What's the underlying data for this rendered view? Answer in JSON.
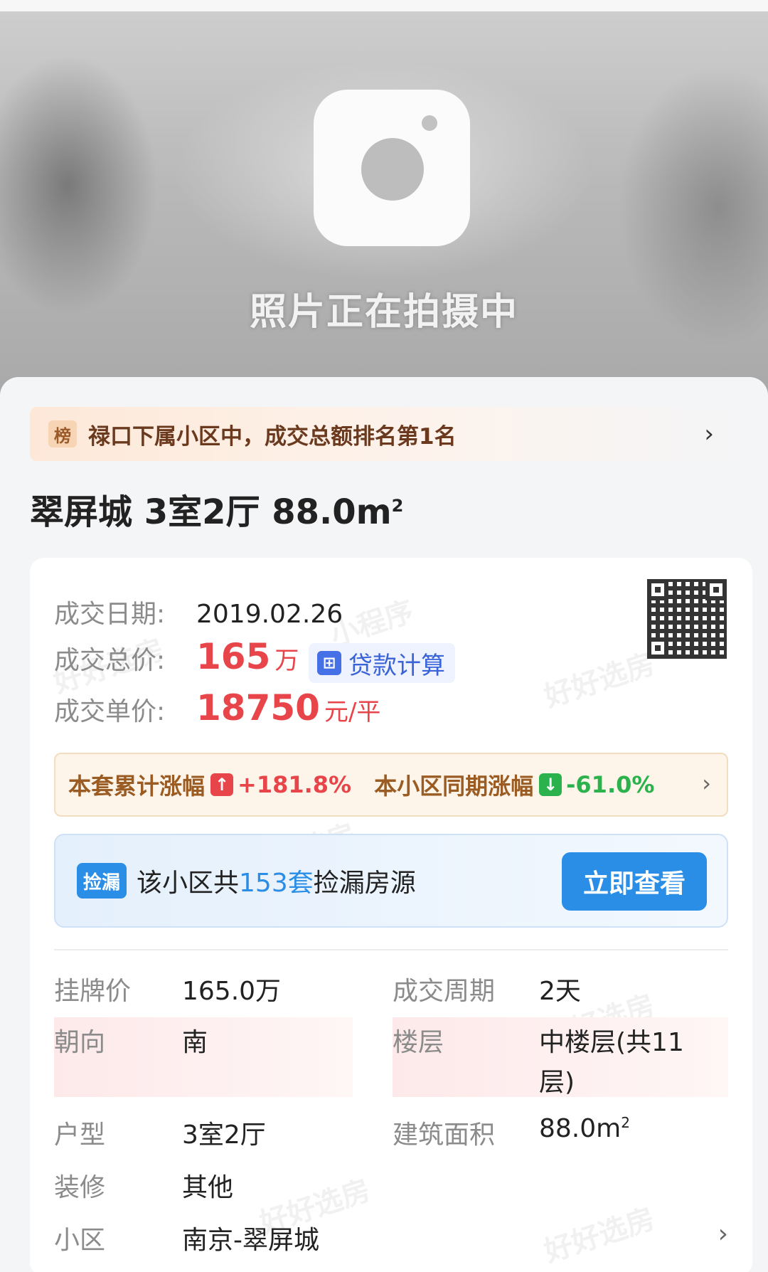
{
  "hero": {
    "caption": "照片正在拍摄中",
    "icon": "camera-icon"
  },
  "rank": {
    "tag": "榜",
    "text": "禄口下属小区中，成交总额排名第1名"
  },
  "title": {
    "text": "翠屏城 3室2厅 88.0m",
    "sup": "2"
  },
  "deal": {
    "date_label": "成交日期:",
    "date_value": "2019.02.26",
    "total_label": "成交总价:",
    "total_value": "165",
    "total_unit": "万",
    "loan_button": "贷款计算",
    "unit_label": "成交单价:",
    "unit_value": "18750",
    "unit_unit": "元/平"
  },
  "trend": {
    "own_label": "本套累计涨幅",
    "own_value": "+181.8%",
    "community_label": "本小区同期涨幅",
    "community_value": "-61.0%"
  },
  "leak": {
    "tag": "捡漏",
    "text_prefix": "该小区共",
    "count": "153套",
    "text_suffix": "捡漏房源",
    "button": "立即查看"
  },
  "details": {
    "listing_price_label": "挂牌价",
    "listing_price_value": "165.0万",
    "cycle_label": "成交周期",
    "cycle_value": "2天",
    "orientation_label": "朝向",
    "orientation_value": "南",
    "floor_label": "楼层",
    "floor_value_line1": "中楼层(共11",
    "floor_value_line2": "层)",
    "layout_label": "户型",
    "layout_value": "3室2厅",
    "area_label": "建筑面积",
    "area_value": "88.0m",
    "area_sup": "2",
    "decor_label": "装修",
    "decor_value": "其他",
    "community_label": "小区",
    "community_value": "南京-翠屏城"
  },
  "watermarks": {
    "a": "小程序",
    "b": "好好选房"
  },
  "colors": {
    "accent_red": "#e8454a",
    "accent_green": "#2bb24c",
    "accent_blue": "#2a8de6",
    "rank_brown": "#6b3a1e"
  }
}
